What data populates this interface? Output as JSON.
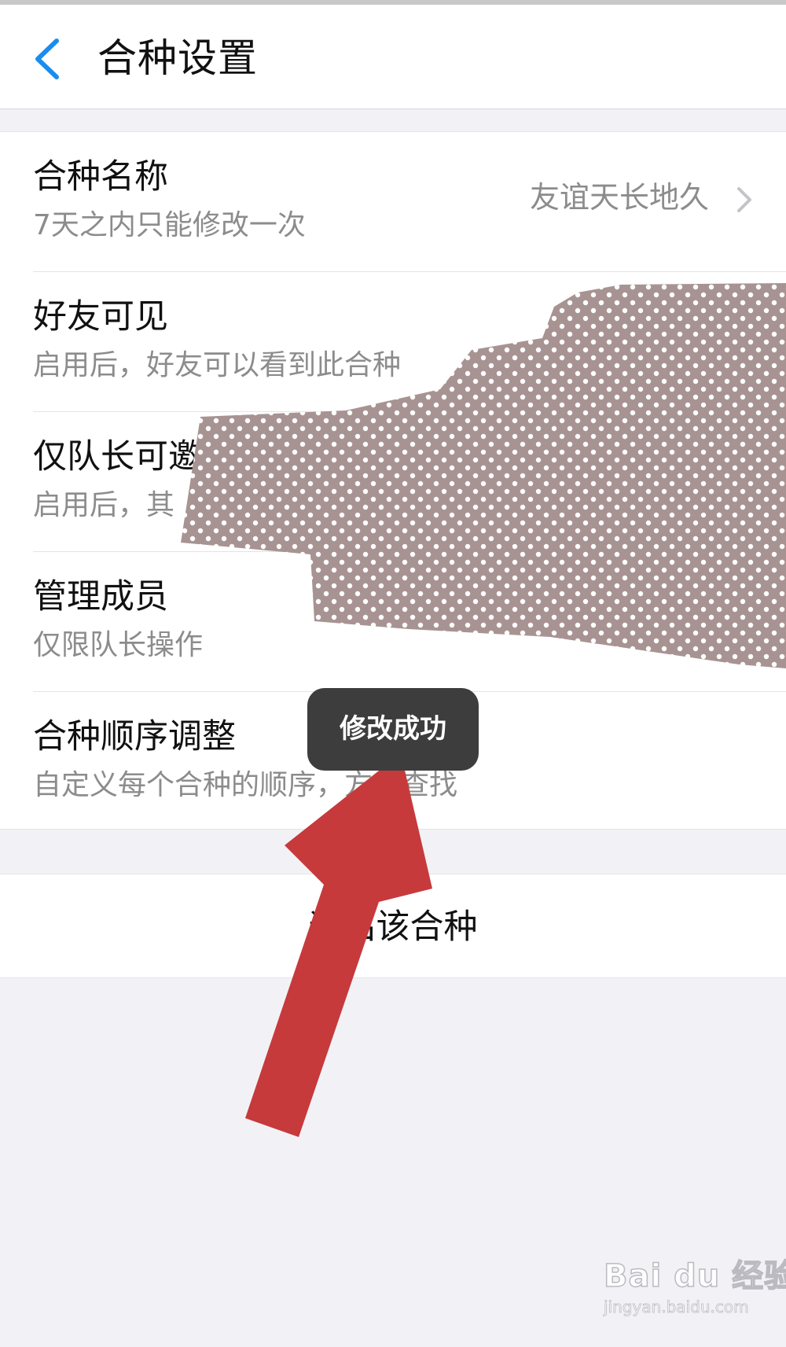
{
  "header": {
    "title": "合种设置",
    "back_icon": "chevron-left-icon",
    "accent_color": "#1a8cf0"
  },
  "settings": {
    "items": [
      {
        "title": "合种名称",
        "subtitle": "7天之内只能修改一次",
        "value": "友谊天长地久",
        "icon": "chevron-right-icon"
      },
      {
        "title": "好友可见",
        "subtitle": "启用后，好友可以看到此合种"
      },
      {
        "title": "仅队长可邀",
        "subtitle": "启用后，其"
      },
      {
        "title": "管理成员",
        "subtitle": "仅限队长操作"
      },
      {
        "title": "合种顺序调整",
        "subtitle": "自定义每个合种的顺序，方便查找"
      }
    ]
  },
  "exit": {
    "label": "退出该合种"
  },
  "toast": {
    "message": "修改成功"
  },
  "annotation": {
    "arrow_color": "#c63a3c",
    "redaction_color": "#a89393"
  },
  "watermark": {
    "brand": "Bai du 经验",
    "url": "jingyan.baidu.com"
  }
}
